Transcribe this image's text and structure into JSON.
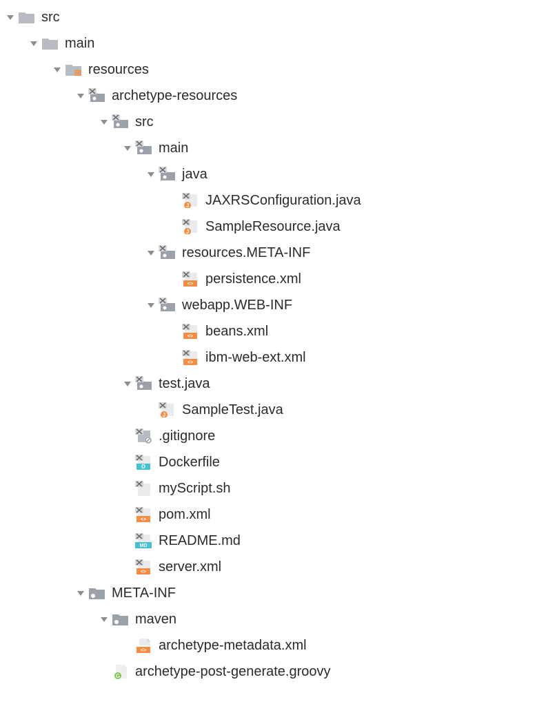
{
  "tree": [
    {
      "depth": 0,
      "expanded": true,
      "icon": "folder",
      "label": "src"
    },
    {
      "depth": 1,
      "expanded": true,
      "icon": "folder",
      "label": "main"
    },
    {
      "depth": 2,
      "expanded": true,
      "icon": "folder-res",
      "label": "resources"
    },
    {
      "depth": 3,
      "expanded": true,
      "icon": "folder-x",
      "label": "archetype-resources"
    },
    {
      "depth": 4,
      "expanded": true,
      "icon": "folder-x",
      "label": "src"
    },
    {
      "depth": 5,
      "expanded": true,
      "icon": "folder-x",
      "label": "main"
    },
    {
      "depth": 6,
      "expanded": true,
      "icon": "folder-x",
      "label": "java"
    },
    {
      "depth": 7,
      "expanded": null,
      "icon": "java-x",
      "label": "JAXRSConfiguration.java"
    },
    {
      "depth": 7,
      "expanded": null,
      "icon": "java-x",
      "label": "SampleResource.java"
    },
    {
      "depth": 6,
      "expanded": true,
      "icon": "folder-x",
      "label": "resources.META-INF"
    },
    {
      "depth": 7,
      "expanded": null,
      "icon": "xml-x",
      "label": "persistence.xml"
    },
    {
      "depth": 6,
      "expanded": true,
      "icon": "folder-x",
      "label": "webapp.WEB-INF"
    },
    {
      "depth": 7,
      "expanded": null,
      "icon": "xml-x",
      "label": "beans.xml"
    },
    {
      "depth": 7,
      "expanded": null,
      "icon": "xml-x",
      "label": "ibm-web-ext.xml"
    },
    {
      "depth": 5,
      "expanded": true,
      "icon": "folder-x",
      "label": "test.java"
    },
    {
      "depth": 6,
      "expanded": null,
      "icon": "java-x",
      "label": "SampleTest.java"
    },
    {
      "depth": 5,
      "expanded": null,
      "icon": "gitignore-x",
      "label": ".gitignore"
    },
    {
      "depth": 5,
      "expanded": null,
      "icon": "docker-x",
      "label": "Dockerfile"
    },
    {
      "depth": 5,
      "expanded": null,
      "icon": "file-x",
      "label": "myScript.sh"
    },
    {
      "depth": 5,
      "expanded": null,
      "icon": "xml-x",
      "label": "pom.xml"
    },
    {
      "depth": 5,
      "expanded": null,
      "icon": "md-x",
      "label": "README.md"
    },
    {
      "depth": 5,
      "expanded": null,
      "icon": "xml-x",
      "label": "server.xml"
    },
    {
      "depth": 3,
      "expanded": true,
      "icon": "folder-dot",
      "label": "META-INF"
    },
    {
      "depth": 4,
      "expanded": true,
      "icon": "folder-dot",
      "label": "maven"
    },
    {
      "depth": 5,
      "expanded": null,
      "icon": "xml-file",
      "label": "archetype-metadata.xml"
    },
    {
      "depth": 4,
      "expanded": null,
      "icon": "groovy",
      "label": "archetype-post-generate.groovy"
    }
  ],
  "colors": {
    "folder": "#b6bcc2",
    "folderDark": "#9aa1a8",
    "accentOrange": "#f48c42",
    "accentTeal": "#46c0d3",
    "accentGreen": "#7cc04b",
    "xMark": "#6a6a6a",
    "arrow": "#8e8e8e"
  }
}
